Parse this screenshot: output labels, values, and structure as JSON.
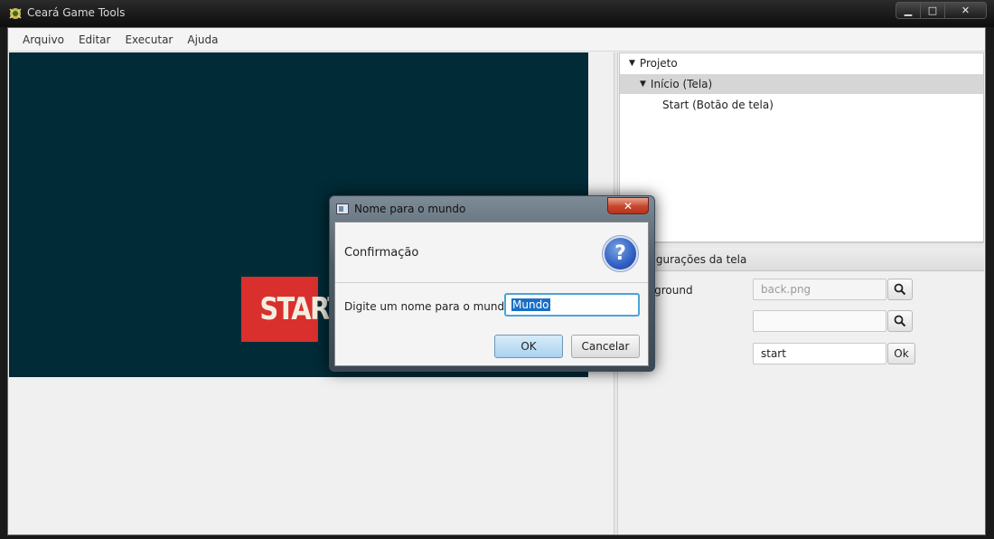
{
  "window": {
    "title": "Ceará Game Tools",
    "controls": {
      "minimize": "▁",
      "maximize": "□",
      "close": "✕"
    }
  },
  "menu": {
    "items": [
      {
        "label": "Arquivo"
      },
      {
        "label": "Editar"
      },
      {
        "label": "Executar"
      },
      {
        "label": "Ajuda"
      }
    ]
  },
  "canvas": {
    "start_button_text": "START",
    "background": "#002b37",
    "button_color": "#d9302e"
  },
  "tree": {
    "root": "Projeto",
    "screen": "Início (Tela)",
    "child": "Start (Botão de tela)"
  },
  "properties": {
    "header": "Configurações da tela",
    "background_label": "Background",
    "background_value": "back.png",
    "second_value": "",
    "name_value": "start",
    "ok_label": "Ok"
  },
  "dialog": {
    "title": "Nome para o mundo",
    "close": "✕",
    "header": "Confirmação",
    "question_icon": "?",
    "prompt": "Digite um nome para o mundo:",
    "input_value": "Mundo",
    "ok_label": "OK",
    "cancel_label": "Cancelar"
  }
}
